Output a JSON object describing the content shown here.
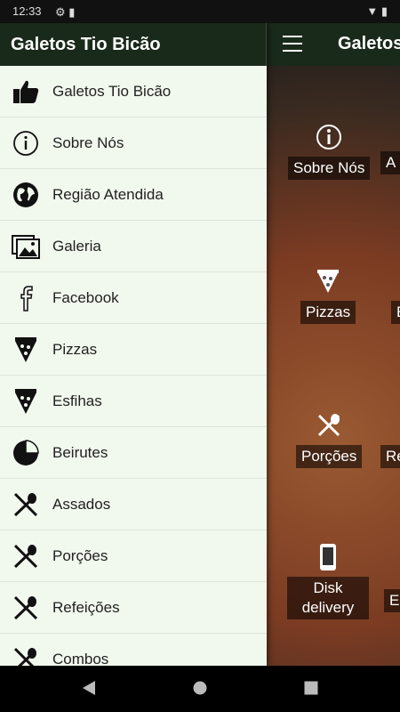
{
  "status_bar": {
    "time": "12:33"
  },
  "app": {
    "title": "Galetos Tio Bicão",
    "title_truncated": "Galetos"
  },
  "drawer": {
    "items": [
      {
        "label": "Galetos Tio Bicão",
        "icon": "thumbs-up-icon"
      },
      {
        "label": "Sobre Nós",
        "icon": "info-icon"
      },
      {
        "label": "Região Atendida",
        "icon": "globe-icon"
      },
      {
        "label": "Galeria",
        "icon": "gallery-icon"
      },
      {
        "label": "Facebook",
        "icon": "facebook-icon"
      },
      {
        "label": "Pizzas",
        "icon": "pizza-slice-icon"
      },
      {
        "label": "Esfihas",
        "icon": "pizza-slice-icon"
      },
      {
        "label": "Beirutes",
        "icon": "pie-chart-icon"
      },
      {
        "label": "Assados",
        "icon": "fork-spoon-icon"
      },
      {
        "label": "Porções",
        "icon": "fork-spoon-icon"
      },
      {
        "label": "Refeições",
        "icon": "fork-spoon-icon"
      },
      {
        "label": "Combos",
        "icon": "fork-spoon-icon"
      }
    ]
  },
  "content": {
    "tiles": [
      {
        "label": "Sobre Nós",
        "icon": "info-icon"
      },
      {
        "label": "Pizzas",
        "icon": "pizza-slice-icon"
      },
      {
        "label": "Porções",
        "icon": "fork-spoon-icon"
      },
      {
        "label": "Disk delivery",
        "icon": "phone-icon"
      }
    ],
    "partial_labels": [
      "A",
      "E",
      "Re",
      "En"
    ]
  },
  "colors": {
    "appbar": "#1a2a1a",
    "drawer_bg": "#f1f8ee"
  }
}
